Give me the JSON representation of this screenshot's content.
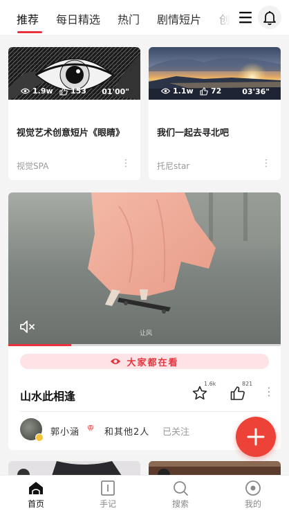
{
  "tabs": [
    {
      "label": "推荐",
      "active": true
    },
    {
      "label": "每日精选",
      "active": false
    },
    {
      "label": "热门",
      "active": false
    },
    {
      "label": "剧情短片",
      "active": false
    },
    {
      "label": "创意",
      "active": false
    }
  ],
  "icons": {
    "menu": "menu-icon",
    "notifications": "bell-icon",
    "mute": "mute-icon",
    "favorite": "star-icon",
    "like": "thumbs-up-icon",
    "add": "plus-icon"
  },
  "colors": {
    "accent": "#e8323c",
    "fab": "#ec4237",
    "pill_bg": "#fde3e6"
  },
  "cards": [
    {
      "views": "1.9w",
      "likes": "153",
      "duration": "01'00\"",
      "title": "视觉艺术创意短片《眼睛》",
      "author": "视觉SPA"
    },
    {
      "views": "1.1w",
      "likes": "72",
      "duration": "03'36\"",
      "title": "我们一起去寻北吧",
      "author": "托尼star"
    }
  ],
  "featured": {
    "watermark": "让风",
    "playback_progress": 0.23,
    "trending_label": "大家都在看",
    "title": "山水此相逢",
    "favorite_count": "1.6k",
    "like_count": "821",
    "author": "郭小涵",
    "coauthors": "和其他2人",
    "follow_status": "已关注"
  },
  "bottom_nav": [
    {
      "label": "首页",
      "active": true
    },
    {
      "label": "手记",
      "active": false
    },
    {
      "label": "搜索",
      "active": false
    },
    {
      "label": "我的",
      "active": false
    }
  ]
}
